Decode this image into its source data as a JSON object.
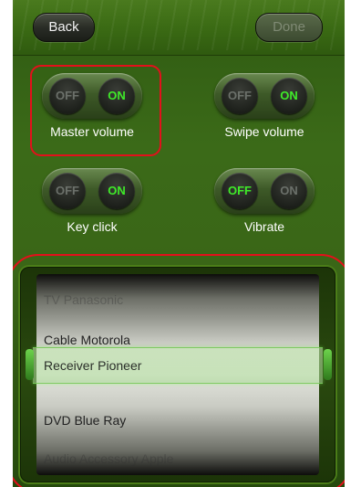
{
  "nav": {
    "back_label": "Back",
    "done_label": "Done"
  },
  "toggles": [
    {
      "label": "Master volume",
      "off_label": "OFF",
      "on_label": "ON",
      "state": "on"
    },
    {
      "label": "Swipe volume",
      "off_label": "OFF",
      "on_label": "ON",
      "state": "on"
    },
    {
      "label": "Key click",
      "off_label": "OFF",
      "on_label": "ON",
      "state": "on"
    },
    {
      "label": "Vibrate",
      "off_label": "OFF",
      "on_label": "ON",
      "state": "off"
    }
  ],
  "picker": {
    "items": [
      "TV Panasonic",
      "Cable Motorola",
      "Receiver  Pioneer",
      "DVD Blue Ray",
      "Audio Accessory Apple"
    ],
    "selected_index": 2
  },
  "colors": {
    "highlight": "#e3101b",
    "active_toggle_text": "#3fea29",
    "background": "#3b6a18"
  }
}
